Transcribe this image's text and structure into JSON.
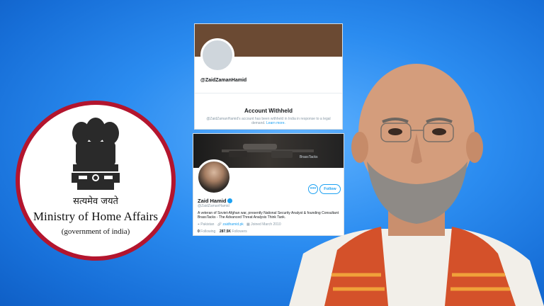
{
  "mha": {
    "motto": "सत्यमेव जयते",
    "ministry": "Ministry of Home Affairs",
    "govt": "(government of india)"
  },
  "withheld_card": {
    "handle": "@ZaidZamanHamid",
    "title": "Account Withheld",
    "text": "@ZaidZamanHamid's account has been withheld in India in response to a legal demand.",
    "learn_more": "Learn more."
  },
  "profile_card": {
    "brand": "BrassTacks",
    "name": "Zaid Hamid",
    "handle": "@ZaidZamanHamid",
    "follow_label": "Follow",
    "more_label": "•••",
    "bio": "A veteran of Soviet-Afghan war, presently National Security Analyst & founding Consultant BrassTacks - The Advanced Threat Analysis Think Tank.",
    "location": "Pakistan",
    "website": "zaidhamid.pk",
    "joined": "Joined March 2010",
    "following_count": "0",
    "following_label": "Following",
    "followers_count": "287.5K",
    "followers_label": "Followers"
  },
  "colors": {
    "background": "#1d7fe6",
    "circle_border": "#b3152e",
    "twitter_blue": "#1da1f2"
  }
}
